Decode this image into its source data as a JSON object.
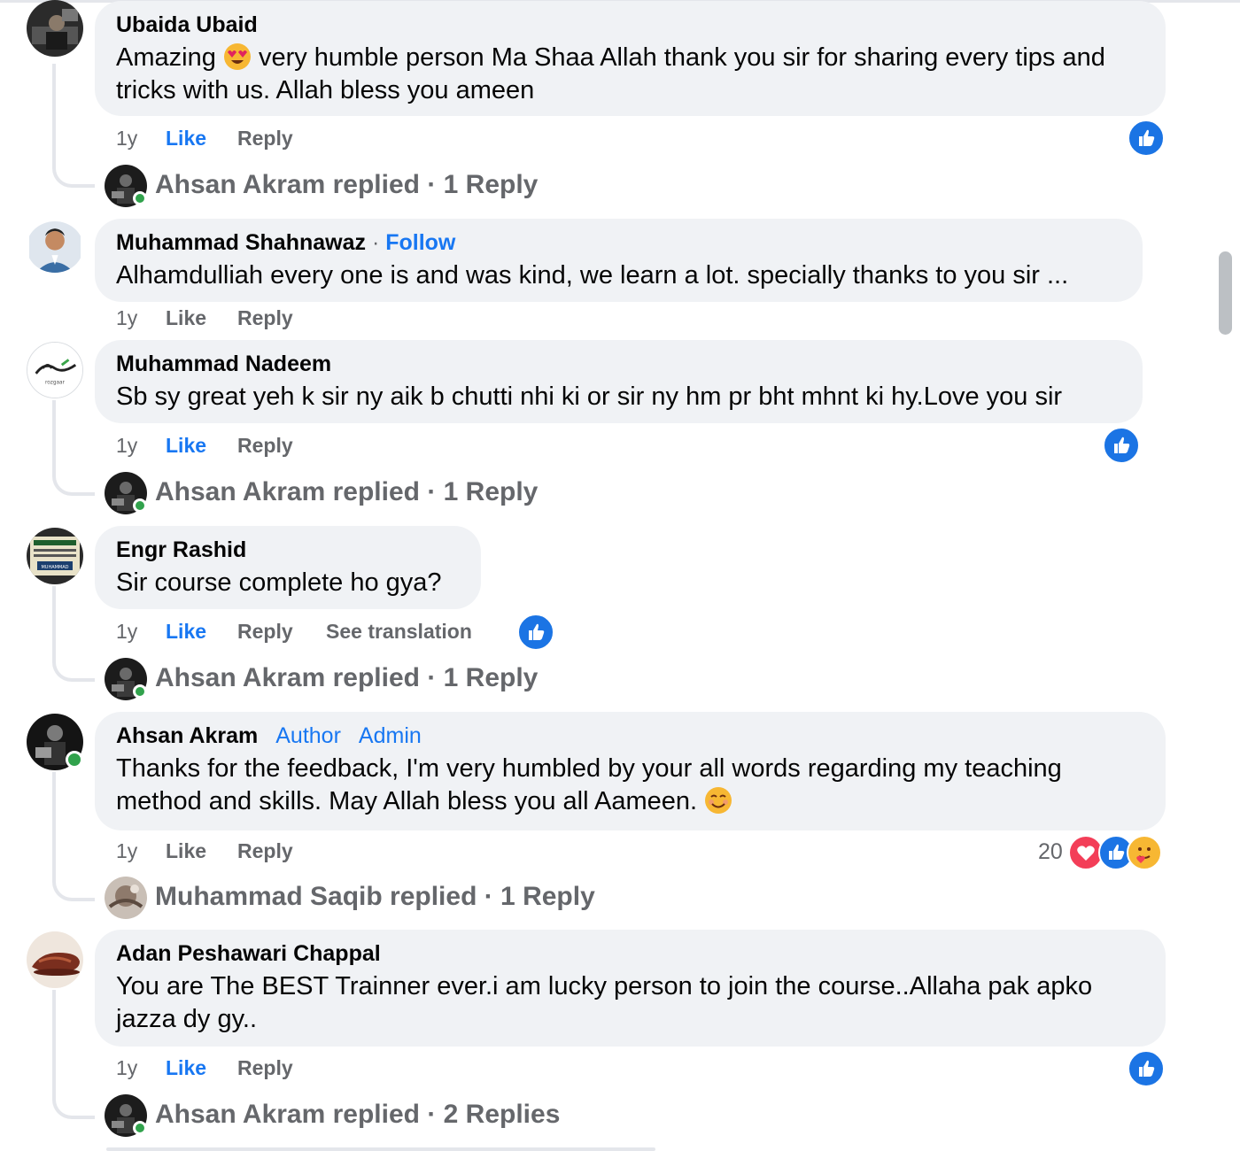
{
  "comments": [
    {
      "author": "Ubaida Ubaid",
      "text_before_emoji": "Amazing ",
      "emoji": "heart-eyes-emoji",
      "text_after_emoji": " very humble person Ma Shaa Allah thank you sir for sharing every tips and tricks with us. Allah bless you ameen",
      "time": "1y",
      "like_label": "Like",
      "reply_label": "Reply",
      "liked": true,
      "replied": {
        "name": "Ahsan Akram",
        "text": "Ahsan Akram replied · 1 Reply"
      }
    },
    {
      "author": "Muhammad Shahnawaz",
      "separator": " · ",
      "follow_label": "Follow",
      "text": "Alhamdulliah every one is and was kind, we learn a lot. specially thanks to you sir ...",
      "time": "1y",
      "like_label": "Like",
      "reply_label": "Reply",
      "liked": false
    },
    {
      "author": "Muhammad Nadeem",
      "text": "Sb sy great yeh k sir ny aik b chutti nhi ki or sir ny hm pr bht mhnt ki hy.Love you sir",
      "time": "1y",
      "like_label": "Like",
      "reply_label": "Reply",
      "liked": true,
      "replied": {
        "name": "Ahsan Akram",
        "text": "Ahsan Akram replied · 1 Reply"
      }
    },
    {
      "author": "Engr Rashid",
      "text": "Sir course complete ho gya?",
      "time": "1y",
      "like_label": "Like",
      "reply_label": "Reply",
      "translation_label": "See translation",
      "liked": true,
      "replied": {
        "name": "Ahsan Akram",
        "text": "Ahsan Akram replied · 1 Reply"
      }
    },
    {
      "author": "Ahsan Akram",
      "badges": [
        "Author",
        "Admin"
      ],
      "text": "Thanks for the feedback, I'm very humbled by your all words regarding my teaching method and skills. May Allah bless you all Aameen. ",
      "emoji": "smiling-emoji",
      "time": "1y",
      "like_label": "Like",
      "reply_label": "Reply",
      "liked": false,
      "reaction_count": "20",
      "reactions": [
        "love-reaction",
        "like-reaction",
        "care-reaction"
      ],
      "replied": {
        "name": "Muhammad Saqib",
        "text": "Muhammad Saqib replied · 1 Reply"
      }
    },
    {
      "author": "Adan Peshawari Chappal",
      "text": "You are The BEST Trainner ever.i am lucky person to join the course..Allaha pak apko jazza dy gy..",
      "time": "1y",
      "like_label": "Like",
      "reply_label": "Reply",
      "liked": true,
      "replied": {
        "name": "Ahsan Akram",
        "text": "Ahsan Akram replied · 2 Replies"
      }
    }
  ],
  "colors": {
    "bubble": "#f0f2f5",
    "link_blue": "#1877f2",
    "muted": "#65676b",
    "online": "#31a24c",
    "like_reaction": "#1b74e4"
  }
}
